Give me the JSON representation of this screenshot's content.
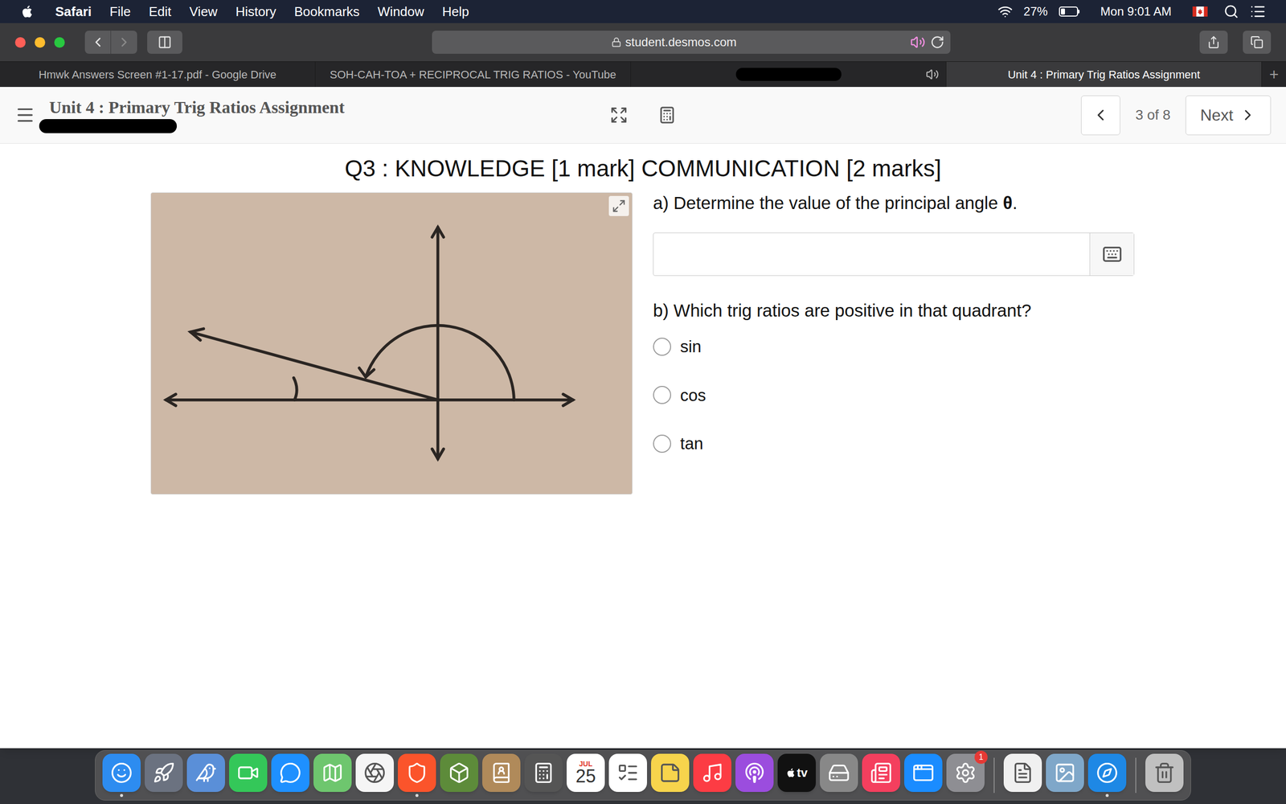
{
  "menu_bar": {
    "app": "Safari",
    "items": [
      "File",
      "Edit",
      "View",
      "History",
      "Bookmarks",
      "Window",
      "Help"
    ],
    "battery": "27%",
    "battery_level": 0.27,
    "clock": "Mon 9:01 AM"
  },
  "toolbar": {
    "url": "student.desmos.com",
    "secure": true,
    "audio_playing": true,
    "back_enabled": true,
    "forward_enabled": false
  },
  "tabs": [
    {
      "label": "Hmwk Answers Screen #1-17.pdf - Google Drive",
      "selected": false,
      "redacted": false,
      "audio": false
    },
    {
      "label": "SOH-CAH-TOA + RECIPROCAL TRIG RATIOS - YouTube",
      "selected": false,
      "redacted": false,
      "audio": false
    },
    {
      "label": "",
      "selected": false,
      "redacted": true,
      "audio": true
    },
    {
      "label": "Unit 4 : Primary Trig Ratios Assignment",
      "selected": true,
      "redacted": false,
      "audio": false
    }
  ],
  "new_tab": "+",
  "header": {
    "title": "Unit 4 : Primary Trig Ratios Assignment",
    "name_redacted": true,
    "counter": "3 of 8",
    "next": "Next",
    "prev_enabled": true
  },
  "question": {
    "title": "Q3 : KNOWLEDGE [1 mark] COMMUNICATION [2 marks]",
    "part_a": {
      "text": "a) Determine the value of the principal angle ",
      "symbol": "θ",
      "end": "."
    },
    "answer": "",
    "part_b": "b) Which trig ratios are positive in that quadrant?",
    "options": [
      {
        "label": "sin",
        "selected": false
      },
      {
        "label": "cos",
        "selected": false
      },
      {
        "label": "tan",
        "selected": false
      }
    ]
  },
  "dock": {
    "items": [
      {
        "kind": "finder",
        "color": "#2d8cf0",
        "running": true
      },
      {
        "kind": "launchpad",
        "color": "#6b7280",
        "running": false
      },
      {
        "kind": "mail",
        "color": "#5a8fd8",
        "running": false
      },
      {
        "kind": "facetime",
        "color": "#34c759",
        "running": false
      },
      {
        "kind": "messages",
        "color": "#1e90ff",
        "running": false
      },
      {
        "kind": "maps",
        "color": "#6ec66e",
        "running": false
      },
      {
        "kind": "photos",
        "color": "#f5f5f5",
        "running": false
      },
      {
        "kind": "brave",
        "color": "#fb542b",
        "running": true
      },
      {
        "kind": "minecraft",
        "color": "#5d8b3a",
        "running": false
      },
      {
        "kind": "contacts",
        "color": "#b08a5a",
        "running": false
      },
      {
        "kind": "calculator",
        "color": "#555555",
        "running": false
      },
      {
        "kind": "calendar",
        "color": "#ffffff",
        "running": false,
        "month": "JUL",
        "day": "25"
      },
      {
        "kind": "reminders",
        "color": "#ffffff",
        "running": false
      },
      {
        "kind": "notes",
        "color": "#f7d44c",
        "running": false
      },
      {
        "kind": "music",
        "color": "#fc3c44",
        "running": false
      },
      {
        "kind": "podcasts",
        "color": "#9b4dde",
        "running": false
      },
      {
        "kind": "tv",
        "color": "#111111",
        "running": false,
        "text": "tv"
      },
      {
        "kind": "utility",
        "color": "#888888",
        "running": false
      },
      {
        "kind": "news",
        "color": "#f43f5e",
        "running": false
      },
      {
        "kind": "appstore",
        "color": "#1a8cff",
        "running": false
      },
      {
        "kind": "settings",
        "color": "#8e8e93",
        "running": false,
        "badge": "1"
      },
      {
        "kind": "separator"
      },
      {
        "kind": "textedit",
        "color": "#f0f0f0",
        "running": false
      },
      {
        "kind": "preview",
        "color": "#7fa7c9",
        "running": false
      },
      {
        "kind": "safari",
        "color": "#1e88e5",
        "running": true
      },
      {
        "kind": "separator"
      },
      {
        "kind": "trash",
        "color": "#c0c0c0",
        "running": false
      }
    ]
  }
}
